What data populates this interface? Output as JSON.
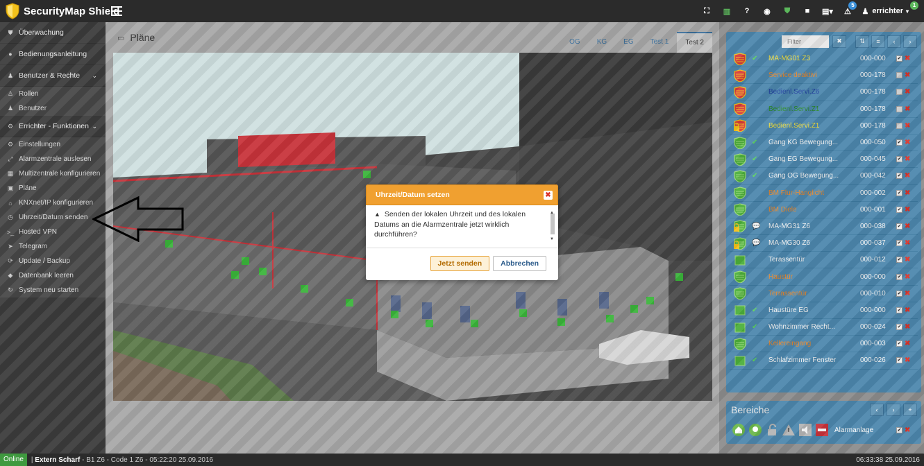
{
  "app": {
    "title": "SecurityMap Shield"
  },
  "topbar": {
    "icons": [
      {
        "name": "fullscreen-icon",
        "glyph": "⛶"
      },
      {
        "name": "columns-icon",
        "glyph": "▥"
      },
      {
        "name": "help-icon",
        "glyph": "?"
      },
      {
        "name": "eye-icon",
        "glyph": "◉"
      },
      {
        "name": "shield-status-icon",
        "glyph": "⛊"
      },
      {
        "name": "camera-icon",
        "glyph": "■"
      },
      {
        "name": "list-menu-icon",
        "glyph": "▤▾"
      }
    ],
    "alerts_count": "5",
    "user_name": "errichter",
    "user_badge": "1"
  },
  "sidebar": {
    "items": [
      {
        "label": "Überwachung",
        "icon": "shield-icon",
        "glyph": "⛊",
        "type": "main"
      },
      {
        "label": "Bedienungsanleitung",
        "icon": "info-icon",
        "glyph": "●",
        "type": "main"
      },
      {
        "label": "Benutzer & Rechte",
        "icon": "users-icon",
        "glyph": "♟",
        "type": "main",
        "chevron": "⌄"
      },
      {
        "label": "Rollen",
        "icon": "role-icon",
        "glyph": "♙",
        "type": "sub"
      },
      {
        "label": "Benutzer",
        "icon": "user-icon",
        "glyph": "♟",
        "type": "sub"
      },
      {
        "label": "Errichter - Funktionen",
        "icon": "gears-icon",
        "glyph": "⚙",
        "type": "main",
        "chevron": "⌄"
      },
      {
        "label": "Einstellungen",
        "icon": "settings-icon",
        "glyph": "⚙",
        "type": "sub"
      },
      {
        "label": "Alarmzentrale auslesen",
        "icon": "read-icon",
        "glyph": "⤢",
        "type": "sub"
      },
      {
        "label": "Multizentrale konfigurieren",
        "icon": "multi-icon",
        "glyph": "▦",
        "type": "sub"
      },
      {
        "label": "Pläne",
        "icon": "map-icon",
        "glyph": "▣",
        "type": "sub"
      },
      {
        "label": "KNXnet/IP konfigurieren",
        "icon": "home-icon",
        "glyph": "⌂",
        "type": "sub"
      },
      {
        "label": "Uhrzeit/Datum senden",
        "icon": "clock-icon",
        "glyph": "◷",
        "type": "sub",
        "active": true
      },
      {
        "label": "Hosted VPN",
        "icon": "terminal-icon",
        "glyph": ">_",
        "type": "sub"
      },
      {
        "label": "Telegram",
        "icon": "telegram-icon",
        "glyph": "➤",
        "type": "sub"
      },
      {
        "label": "Update / Backup",
        "icon": "refresh-icon",
        "glyph": "⟳",
        "type": "sub"
      },
      {
        "label": "Datenbank leeren",
        "icon": "eraser-icon",
        "glyph": "◆",
        "type": "sub"
      },
      {
        "label": "System neu starten",
        "icon": "restart-icon",
        "glyph": "↻",
        "type": "sub"
      }
    ]
  },
  "main": {
    "title": "Pläne",
    "tabs": [
      {
        "label": "OG",
        "active": false
      },
      {
        "label": "KG",
        "active": false
      },
      {
        "label": "EG",
        "active": false
      },
      {
        "label": "Test 1",
        "active": false
      },
      {
        "label": "Test 2",
        "active": true
      }
    ]
  },
  "zones": {
    "filter_placeholder": "Filter",
    "rows": [
      {
        "name": "MA-MG01 Z3",
        "code": "000-000",
        "color": "c-yel",
        "icon": "red",
        "check": true,
        "active": true,
        "lock": false
      },
      {
        "name": "Service deaktivi",
        "code": "000-178",
        "color": "c-org",
        "icon": "red",
        "check": false,
        "active": false,
        "lock": false
      },
      {
        "name": "Bedienl.Servi.Z6",
        "code": "000-178",
        "color": "c-blu",
        "icon": "red",
        "check": false,
        "active": false,
        "lock": false
      },
      {
        "name": "Bedienl.Servi.Z1",
        "code": "000-178",
        "color": "c-grn",
        "icon": "red",
        "check": false,
        "active": false,
        "lock": false
      },
      {
        "name": "Bedienl.Servi.Z1",
        "code": "000-178",
        "color": "c-yel",
        "icon": "red",
        "check": false,
        "active": false,
        "lock": true
      },
      {
        "name": "Gang KG Bewegung...",
        "code": "000-050",
        "color": "c-wht",
        "icon": "green",
        "check": true,
        "active": true,
        "lock": false
      },
      {
        "name": "Gang EG Bewegung...",
        "code": "000-045",
        "color": "c-wht",
        "icon": "green",
        "check": true,
        "active": true,
        "lock": false
      },
      {
        "name": "Gang OG Bewegung...",
        "code": "000-042",
        "color": "c-wht",
        "icon": "green",
        "check": true,
        "active": true,
        "lock": false
      },
      {
        "name": "BM Flur-Hanglicht",
        "code": "000-002",
        "color": "c-org",
        "icon": "green",
        "check": false,
        "active": true,
        "lock": false
      },
      {
        "name": "BM Diele",
        "code": "000-001",
        "color": "c-org",
        "icon": "green",
        "check": false,
        "active": true,
        "lock": false
      },
      {
        "name": "MA-MG31 Z6",
        "code": "000-038",
        "color": "c-wht",
        "icon": "green",
        "check": false,
        "active": true,
        "lock": true,
        "chat": true
      },
      {
        "name": "MA-MG30 Z6",
        "code": "000-037",
        "color": "c-wht",
        "icon": "green",
        "check": false,
        "active": true,
        "lock": true,
        "chat": true
      },
      {
        "name": "Terassentür",
        "code": "000-012",
        "color": "c-wht",
        "icon": "square",
        "check": false,
        "active": true,
        "lock": false
      },
      {
        "name": "Haustür",
        "code": "000-000",
        "color": "c-org",
        "icon": "green",
        "check": false,
        "active": true,
        "lock": false
      },
      {
        "name": "Terrassentür",
        "code": "000-010",
        "color": "c-org",
        "icon": "green",
        "check": false,
        "active": true,
        "lock": false
      },
      {
        "name": "Haustüre EG",
        "code": "000-000",
        "color": "c-wht",
        "icon": "square",
        "check": true,
        "active": true,
        "lock": false
      },
      {
        "name": "Wohnzimmer Recht...",
        "code": "000-024",
        "color": "c-wht",
        "icon": "square",
        "check": true,
        "active": true,
        "lock": false
      },
      {
        "name": "Kellereingang",
        "code": "000-003",
        "color": "c-org",
        "icon": "green",
        "check": false,
        "active": true,
        "lock": false
      },
      {
        "name": "Schlafzimmer Fenster",
        "code": "000-026",
        "color": "c-wht",
        "icon": "square",
        "check": true,
        "active": true,
        "lock": false
      }
    ]
  },
  "bereiche": {
    "title": "Bereiche",
    "row_label": "Alarmanlage"
  },
  "modal": {
    "title": "Uhrzeit/Datum setzen",
    "message": "Senden der lokalen Uhrzeit und des lokalen Datums an die Alarmzentrale jetzt wirklich durchführen?",
    "confirm_label": "Jetzt senden",
    "cancel_label": "Abbrechen"
  },
  "status": {
    "online_label": "Online",
    "text_bold": "Extern Scharf",
    "text_rest": " - B1 Z6 - Code 1 Z6 - 05:22:20 25.09.2016",
    "separator": "|",
    "time": "06:33:38 25.09.2016"
  }
}
